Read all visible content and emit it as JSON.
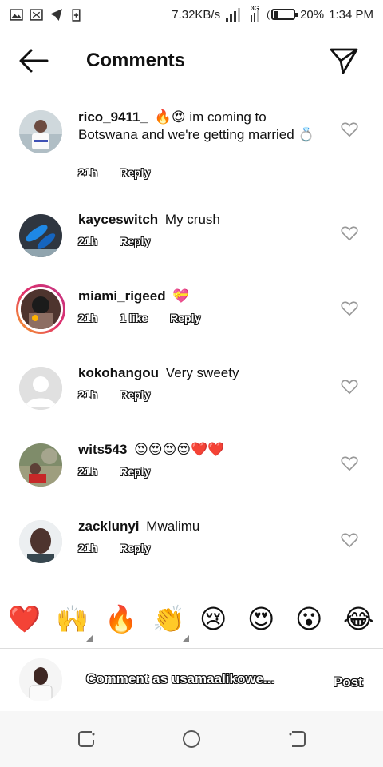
{
  "status_bar": {
    "speed": "7.32KB/s",
    "network": "3G",
    "battery_percent": "20%",
    "battery_level": 0.2,
    "time": "1:34 PM"
  },
  "header": {
    "title": "Comments",
    "back_icon": "arrow-left-icon",
    "send_icon": "paper-plane-icon"
  },
  "comments": [
    {
      "username": "rico_9411_",
      "text": "🔥😍 im coming to Botswana and we're getting married 💍",
      "time": "21h",
      "likes": "",
      "reply": "Reply"
    },
    {
      "username": "kayceswitch",
      "text": "My crush",
      "time": "21h",
      "likes": "",
      "reply": "Reply"
    },
    {
      "username": "miami_rigeed",
      "text": "💝",
      "time": "21h",
      "likes": "1 like",
      "reply": "Reply"
    },
    {
      "username": "kokohangou",
      "text": "Very sweety",
      "time": "21h",
      "likes": "",
      "reply": "Reply"
    },
    {
      "username": "wits543",
      "text": "😍😍😍😍❤️❤️",
      "time": "21h",
      "likes": "",
      "reply": "Reply"
    },
    {
      "username": "zacklunyi",
      "text": "Mwalimu",
      "time": "21h",
      "likes": "",
      "reply": "Reply"
    }
  ],
  "reactions": [
    "❤️",
    "🙌",
    "🔥",
    "👏",
    "😢",
    "😍",
    "😮",
    "😂"
  ],
  "composer": {
    "placeholder": "Comment as usamaalikowe...",
    "post_label": "Post"
  },
  "colors": {
    "story_ring_start": "#f9a825",
    "story_ring_end": "#c13584",
    "heart": "#e0245e"
  }
}
